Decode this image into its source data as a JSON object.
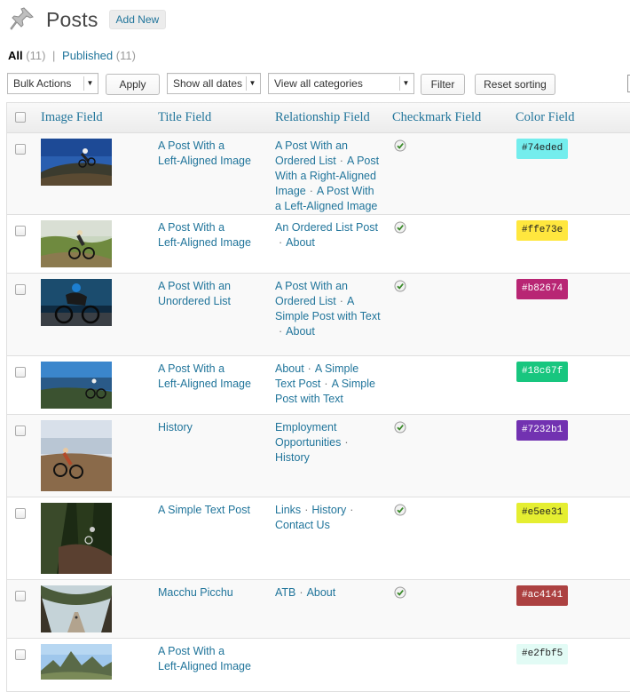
{
  "header": {
    "title": "Posts",
    "add_new": "Add New"
  },
  "views": {
    "all_label": "All",
    "all_count": "(11)",
    "separator": "|",
    "published_label": "Published",
    "published_count": "(11)"
  },
  "toolbar": {
    "bulk_actions": "Bulk Actions",
    "apply": "Apply",
    "dates": "Show all dates",
    "categories": "View all categories",
    "filter": "Filter",
    "reset_sorting": "Reset sorting"
  },
  "columns": {
    "image": "Image Field",
    "title": "Title Field",
    "relationship": "Relationship Field",
    "checkmark": "Checkmark Field",
    "color": "Color Field"
  },
  "rows": [
    {
      "title_lines": [
        "A Post With a",
        "Left-Aligned Image"
      ],
      "relationship_lines": [
        [
          {
            "t": "A Post With an"
          }
        ],
        [
          {
            "t": "Ordered List"
          },
          {
            "t": "A Post",
            "dot": true
          }
        ],
        [
          {
            "t": "With a Right-Aligned"
          }
        ],
        [
          {
            "t": "Image"
          },
          {
            "t": "A Post With",
            "dot": true
          }
        ],
        [
          {
            "t": "a Left-Aligned Image"
          }
        ]
      ],
      "checked": true,
      "color": "#74eded",
      "thumb": "cycling-hill"
    },
    {
      "title_lines": [
        "A Post With a",
        "Left-Aligned Image"
      ],
      "relationship_lines": [
        [
          {
            "t": "An Ordered List Post"
          }
        ],
        [
          {
            "t": "About",
            "dot": true
          }
        ]
      ],
      "checked": true,
      "color": "#ffe73e",
      "thumb": "cycling-trail"
    },
    {
      "title_lines": [
        "A Post With an",
        "Unordered List"
      ],
      "relationship_lines": [
        [
          {
            "t": "A Post With an"
          }
        ],
        [
          {
            "t": "Ordered List"
          },
          {
            "t": "A",
            "dot": true
          }
        ],
        [
          {
            "t": "Simple Post with Text"
          }
        ],
        [
          {
            "t": "About",
            "dot": true
          }
        ]
      ],
      "checked": true,
      "color": "#b82674",
      "thumb": "cycling-road"
    },
    {
      "title_lines": [
        "A Post With a",
        "Left-Aligned Image"
      ],
      "relationship_lines": [
        [
          {
            "t": "About"
          },
          {
            "t": "A Simple",
            "dot": true
          }
        ],
        [
          {
            "t": "Text Post"
          },
          {
            "t": "A Simple",
            "dot": true
          }
        ],
        [
          {
            "t": "Post with Text"
          }
        ]
      ],
      "checked": false,
      "color": "#18c67f",
      "thumb": "cycling-lake"
    },
    {
      "title_lines": [
        "History"
      ],
      "relationship_lines": [
        [
          {
            "t": "Employment"
          }
        ],
        [
          {
            "t": "Opportunities"
          },
          {
            "t": "",
            "dot": true
          }
        ],
        [
          {
            "t": "History"
          }
        ]
      ],
      "checked": true,
      "color": "#7232b1",
      "thumb": "cycling-coast"
    },
    {
      "title_lines": [
        "A Simple Text Post"
      ],
      "relationship_lines": [
        [
          {
            "t": "Links"
          },
          {
            "t": "History",
            "dot": true
          },
          {
            "t": "",
            "dot": true
          }
        ],
        [
          {
            "t": "Contact Us"
          }
        ]
      ],
      "checked": true,
      "color": "#e5ee31",
      "thumb": "forest"
    },
    {
      "title_lines": [
        "Macchu Picchu"
      ],
      "relationship_lines": [
        [
          {
            "t": "ATB"
          },
          {
            "t": "About",
            "dot": true
          }
        ]
      ],
      "checked": true,
      "color": "#ac4141",
      "thumb": "oak-avenue"
    },
    {
      "title_lines": [
        "A Post With a",
        "Left-Aligned Image"
      ],
      "relationship_lines": [],
      "checked": false,
      "color": "#e2fbf5",
      "thumb": "mountains"
    }
  ]
}
